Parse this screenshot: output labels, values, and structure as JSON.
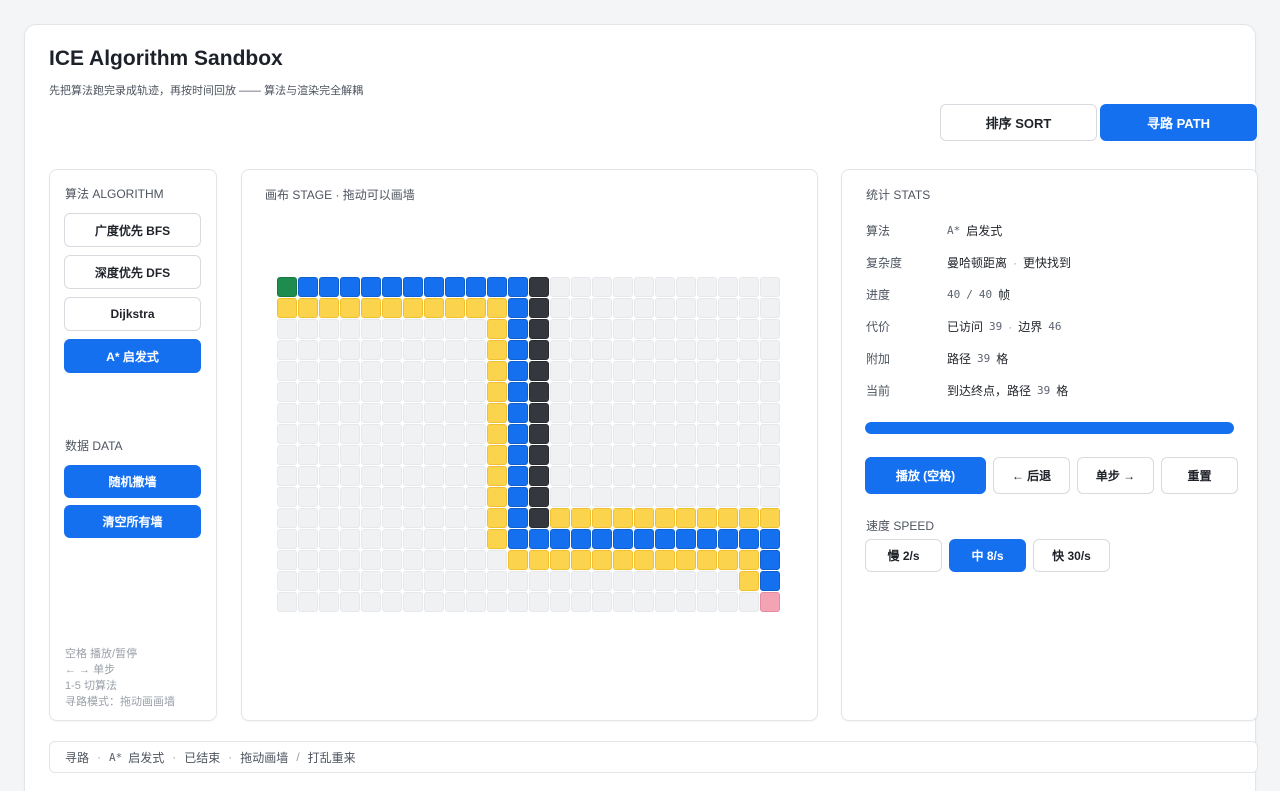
{
  "app": {
    "title": "ICE Algorithm Sandbox",
    "subtitle": "先把算法跑完录成轨迹，再按时间回放 —— 算法与渲染完全解耦"
  },
  "mode_tabs": [
    {
      "label": "排序 SORT",
      "active": false
    },
    {
      "label": "寻路 PATH",
      "active": true
    }
  ],
  "left_panel": {
    "algorithm_label": "算法 ALGORITHM",
    "algorithms": [
      {
        "label": "广度优先 BFS",
        "active": false
      },
      {
        "label": "深度优先 DFS",
        "active": false
      },
      {
        "label": "Dijkstra",
        "active": false
      },
      {
        "label": "A* 启发式",
        "active": true
      }
    ],
    "data_label": "数据 DATA",
    "data_buttons": [
      "随机撒墙",
      "清空所有墙"
    ],
    "hints": [
      "空格 播放/暂停",
      "← → 单步",
      "1-5 切算法",
      "寻路模式：拖动画画墙"
    ]
  },
  "stage": {
    "label": "画布 STAGE · 拖动可以画墙",
    "legend_colors": {
      "start": "#1e8c4e",
      "path": "#1570ef",
      "wall": "#34373d",
      "visited": "#fcd34d",
      "end": "#f4a3b5",
      "empty": "#f0f1f3"
    },
    "grid_rows": [
      "SPPPPPPPPPPPW...........",
      "VVVVVVVVVVVPW...........",
      "..........VPW...........",
      "..........VPW...........",
      "..........VPW...........",
      "..........VPW...........",
      "..........VPW...........",
      "..........VPW...........",
      "..........VPW...........",
      "..........VPW...........",
      "..........VPW...........",
      "..........VPWVVVVVVVVVVV",
      "..........VPPPPPPPPPPPPP",
      "...........VVVVVVVVVVVVP",
      "......................VP",
      ".......................E"
    ]
  },
  "stats": {
    "label": "统计 STATS",
    "algorithm": {
      "key": "算法",
      "prefix": "A*",
      "value": "启发式"
    },
    "complexity": {
      "key": "复杂度",
      "value": "曼哈顿距离",
      "sep": "·",
      "extra": "更快找到"
    },
    "progress": {
      "key": "进度",
      "current": "40",
      "slash": "/",
      "total": "40",
      "unit": "帧"
    },
    "cost": {
      "key": "代价",
      "visited_label": "已访问",
      "visited": "39",
      "sep": "·",
      "frontier_label": "边界",
      "frontier": "46"
    },
    "extra": {
      "key": "附加",
      "path_label": "路径",
      "path": "39",
      "unit": "格"
    },
    "current": {
      "key": "当前",
      "value": "到达终点，路径",
      "path": "39",
      "unit": "格"
    },
    "progress_fraction": 1.0
  },
  "controls": {
    "play": "播放 (空格)",
    "back": "← 后退",
    "step": "单步 →",
    "reset": "重置"
  },
  "speed": {
    "label": "速度 SPEED",
    "options": [
      {
        "label": "慢 2/s",
        "active": false
      },
      {
        "label": "中 8/s",
        "active": true
      },
      {
        "label": "快 30/s",
        "active": false
      }
    ]
  },
  "footer": {
    "mode": "寻路",
    "algo_prefix": "A*",
    "algo": "启发式",
    "state": "已结束",
    "hint1": "拖动画墙",
    "slash": "/",
    "hint2": "打乱重来",
    "dot": "·"
  }
}
